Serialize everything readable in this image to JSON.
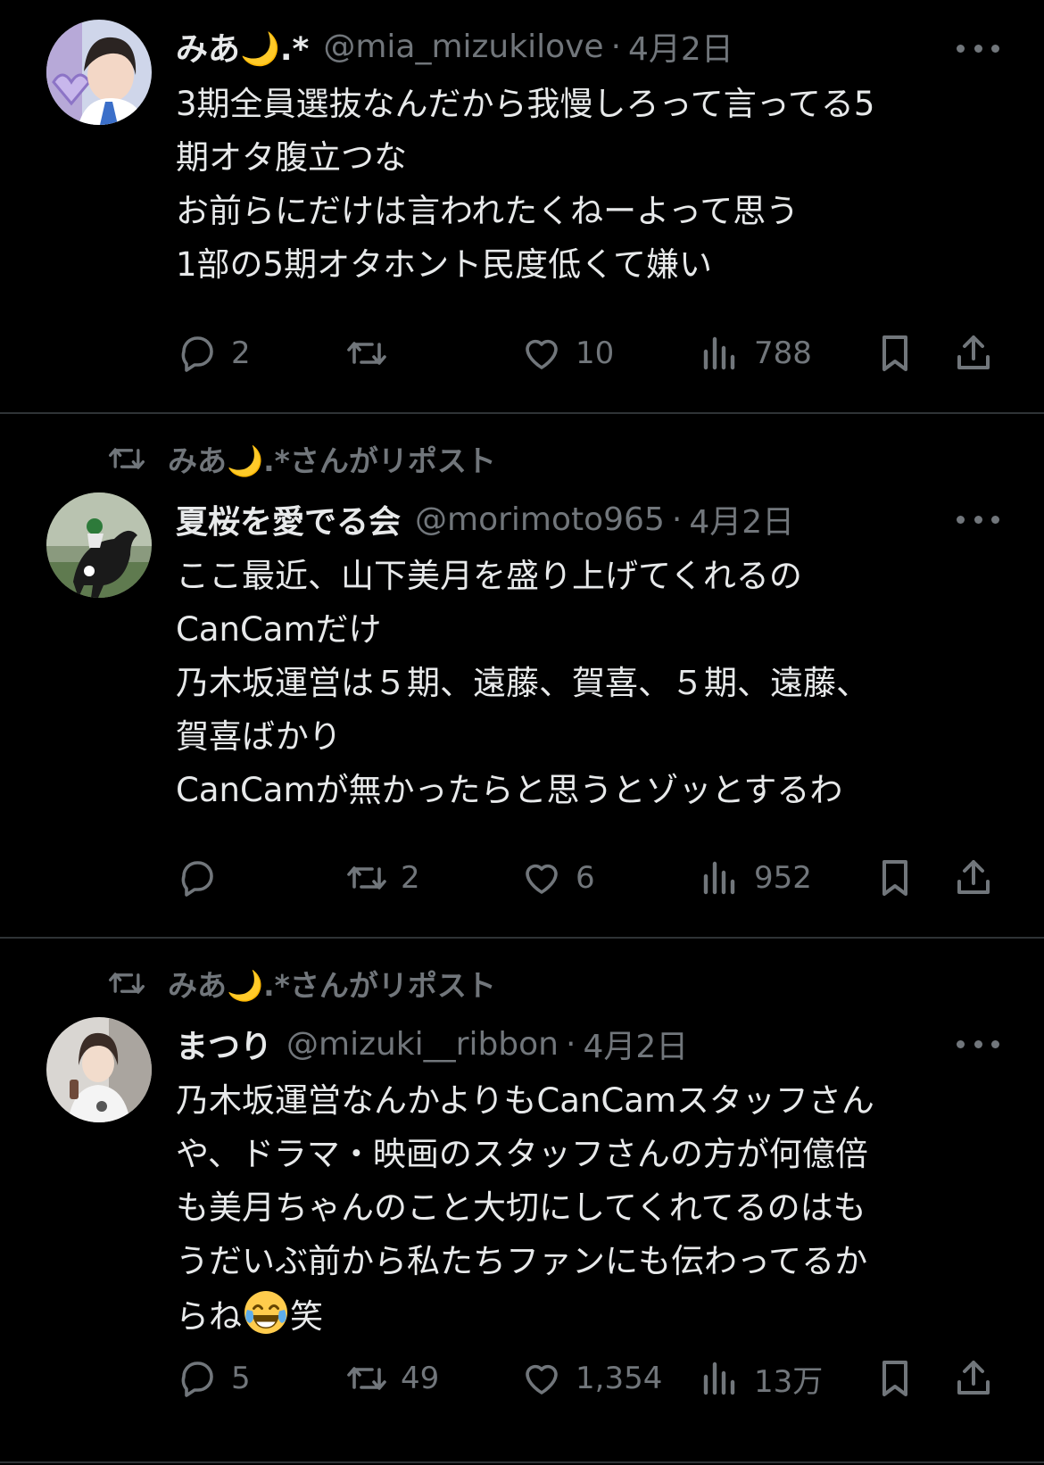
{
  "tweets": [
    {
      "repost_label": "",
      "name": "みあ🌙.*",
      "handle": "@mia_mizukilove",
      "separator": "·",
      "date": "4月2日",
      "text": "3期全員選抜なんだから我慢しろって言ってる5\n期オタ腹立つな\nお前らにだけは言われたくねーよって思う\n1部の5期オタホント民度低くて嫌い",
      "replies": "2",
      "reposts": "",
      "likes": "10",
      "views": "788"
    },
    {
      "repost_label": "みあ🌙.*さんがリポスト",
      "name": "夏桜を愛でる会",
      "handle": "@morimoto965",
      "separator": "·",
      "date": "4月2日",
      "text": "ここ最近、山下美月を盛り上げてくれるの\nCanCamだけ\n乃木坂運営は５期、遠藤、賀喜、５期、遠藤、\n賀喜ばかり\nCanCamが無かったらと思うとゾッとするわ",
      "replies": "",
      "reposts": "2",
      "likes": "6",
      "views": "952"
    },
    {
      "repost_label": "みあ🌙.*さんがリポスト",
      "name": "まつり",
      "handle": "@mizuki__ribbon",
      "separator": "·",
      "date": "4月2日",
      "text": "乃木坂運営なんかよりもCanCamスタッフさん\nや、ドラマ・映画のスタッフさんの方が何億倍\nも美月ちゃんのこと大切にしてくれてるのはも\nうだいぶ前から私たちファンにも伝わってるか\nらね",
      "text_tail": "笑",
      "replies": "5",
      "reposts": "49",
      "likes": "1,354",
      "views": "13万"
    }
  ],
  "colors": {
    "background": "#000000",
    "text": "#e7e9ea",
    "muted": "#71767b",
    "divider": "#2f3336"
  },
  "icons": [
    "reply-icon",
    "repost-icon",
    "like-icon",
    "views-icon",
    "bookmark-icon",
    "share-icon",
    "more-icon",
    "laughing-emoji"
  ]
}
